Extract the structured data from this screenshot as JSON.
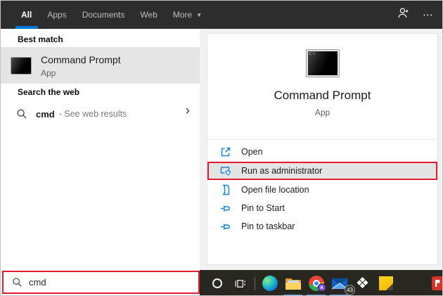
{
  "topbar": {
    "tabs": [
      {
        "label": "All",
        "selected": true
      },
      {
        "label": "Apps",
        "selected": false
      },
      {
        "label": "Documents",
        "selected": false
      },
      {
        "label": "Web",
        "selected": false
      },
      {
        "label": "More",
        "selected": false
      }
    ]
  },
  "icons": {
    "more_caret": "▼",
    "ellipsis": "⋯",
    "chevron_right": "›",
    "dropbox_glyph": "❖",
    "chrome_badge": "A",
    "cmd_icon_text": "C:\\"
  },
  "left_panel": {
    "best_match_header": "Best match",
    "best_match": {
      "title": "Command Prompt",
      "subtitle": "App"
    },
    "web_header": "Search the web",
    "web_result": {
      "query": "cmd",
      "suffix": "- See web results"
    }
  },
  "right_panel": {
    "title": "Command Prompt",
    "subtitle": "App",
    "actions": [
      {
        "label": "Open"
      },
      {
        "label": "Run as administrator",
        "highlighted": true
      },
      {
        "label": "Open file location"
      },
      {
        "label": "Pin to Start"
      },
      {
        "label": "Pin to taskbar"
      }
    ]
  },
  "search_box": {
    "value": "cmd"
  },
  "taskbar": {
    "mail_badge": "43"
  },
  "colors": {
    "accent_blue": "#0078d7",
    "annotation_red": "#e11d2e",
    "action_icon_blue": "#1a86d9",
    "taskbar_underline": "#5c9fd6",
    "topbar_bg": "#2d2d2d",
    "taskbar_bg": "#282720",
    "highlight_gray": "#e5e5e5"
  }
}
